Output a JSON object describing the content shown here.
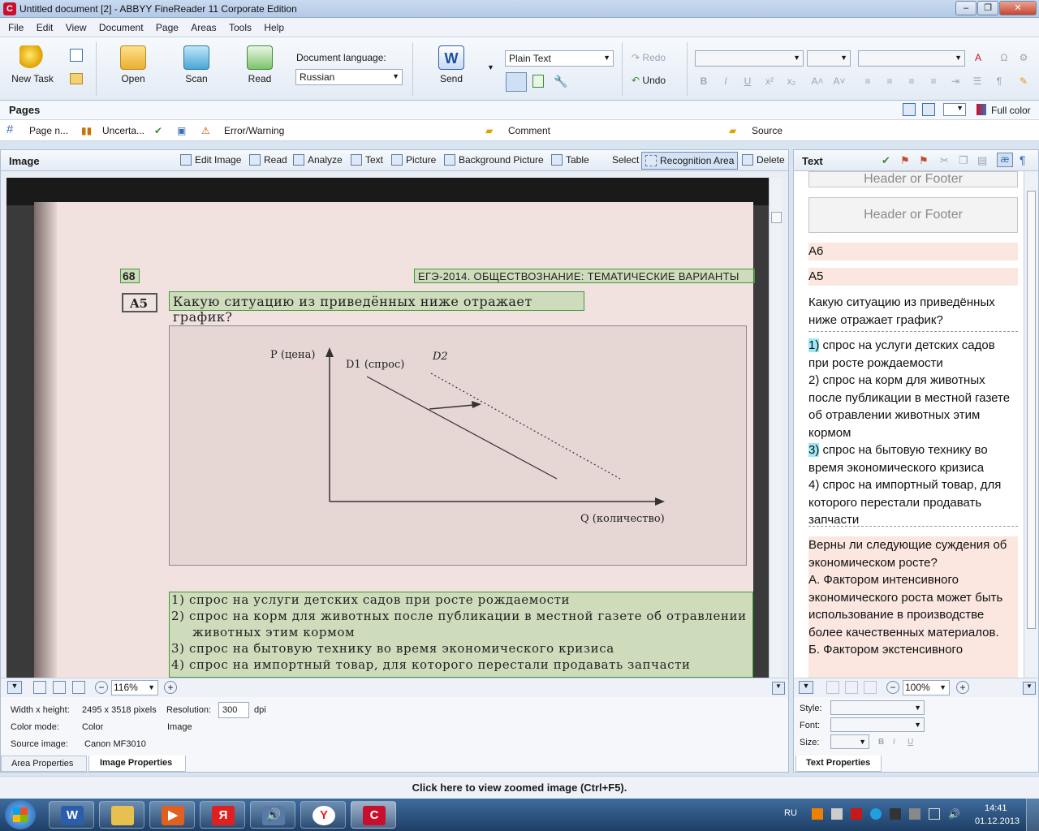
{
  "window": {
    "title": "Untitled document [2] - ABBYY FineReader 11 Corporate Edition"
  },
  "menu": [
    "File",
    "Edit",
    "View",
    "Document",
    "Page",
    "Areas",
    "Tools",
    "Help"
  ],
  "ribbon": {
    "new_task": "New Task",
    "open": "Open",
    "scan": "Scan",
    "read": "Read",
    "doc_lang_label": "Document language:",
    "doc_lang_value": "Russian",
    "send": "Send",
    "format_value": "Plain Text",
    "redo": "Redo",
    "undo": "Undo"
  },
  "pages": {
    "title": "Pages",
    "full_color": "Full color",
    "filters": [
      "Page n...",
      "Uncerta...",
      "Error/Warning",
      "Comment",
      "Source"
    ]
  },
  "image_panel": {
    "title": "Image",
    "tools": [
      "Edit Image",
      "Read",
      "Analyze",
      "Text",
      "Picture",
      "Background Picture",
      "Table",
      "Select",
      "Recognition Area",
      "Delete"
    ],
    "zoom": "116%",
    "props": {
      "wh_label": "Width x height:",
      "wh_value": "2495 x 3518 pixels",
      "res_label": "Resolution:",
      "res_value": "300",
      "res_unit": "dpi",
      "color_label": "Color mode:",
      "color_value": "Color",
      "color_value2": "Image",
      "source_label": "Source image:",
      "source_value": "Canon MF3010"
    },
    "tabs": [
      "Area Properties",
      "Image Properties"
    ]
  },
  "scan": {
    "page_num": "68",
    "header": "ЕГЭ-2014. ОБЩЕСТВОЗНАНИЕ: ТЕМАТИЧЕСКИЕ ВАРИАНТЫ",
    "q_label": "A5",
    "question": "Какую ситуацию из приведённых ниже отражает график?",
    "chart_p": "P (цена)",
    "chart_d1": "D1 (спрос)",
    "chart_d2": "D2",
    "chart_q": "Q (количество)",
    "answers": [
      "1) спрос на услуги детских садов при росте рождаемости",
      "2) спрос на корм для животных после публикации в местной газете об отравлении",
      "животных этим кормом",
      "3) спрос на бытовую технику во время экономического кризиса",
      "4) спрос на импортный товар, для которого перестали продавать запчасти"
    ]
  },
  "text_panel": {
    "title": "Text",
    "header_footer": "Header or Footer",
    "a6": "А6",
    "a5": "А5",
    "question": "Какую ситуацию из приведённых ниже отражает график?",
    "ans1_num": "1)",
    "ans1": " спрос на услуги детских садов при росте рождаемости",
    "ans2": "2) спрос на корм для животных после публикации в местной газете об отравлении животных этим кормом",
    "ans3_num": "3)",
    "ans3": " спрос на бытовую технику во время экономического кризиса",
    "ans4": "4) спрос на импортный товар, для которого перестали продавать запчасти",
    "next": "Верны ли следующие суждения об экономическом росте?",
    "next_a": "А. Фактором интенсивного экономического роста может быть использование в производстве более качественных материалов.",
    "next_b": "Б. Фактором экстенсивного",
    "zoom": "100%",
    "style_label": "Style:",
    "font_label": "Font:",
    "size_label": "Size:",
    "tab": "Text Properties"
  },
  "status": "Click here to view zoomed image (Ctrl+F5).",
  "taskbar": {
    "lang": "RU",
    "time": "14:41",
    "date": "01.12.2013"
  }
}
